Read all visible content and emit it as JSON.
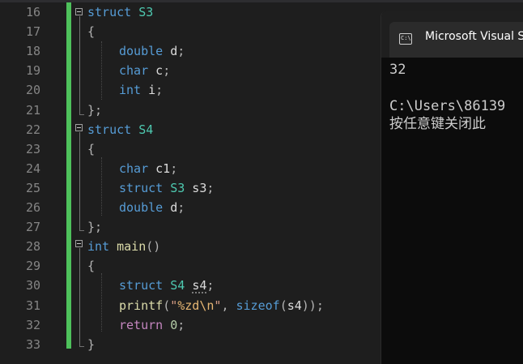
{
  "editor": {
    "lines": [
      {
        "n": "16",
        "parts": [
          [
            "kw",
            "struct"
          ],
          [
            "id",
            " "
          ],
          [
            "ty",
            "S3"
          ]
        ]
      },
      {
        "n": "17",
        "parts": [
          [
            "pu",
            "{"
          ]
        ]
      },
      {
        "n": "18",
        "parts": [
          [
            "ins",
            ""
          ],
          [
            "kw",
            "double"
          ],
          [
            "id",
            " d"
          ],
          [
            "pu",
            ";"
          ]
        ]
      },
      {
        "n": "19",
        "parts": [
          [
            "ins",
            ""
          ],
          [
            "kw",
            "char"
          ],
          [
            "id",
            " c"
          ],
          [
            "pu",
            ";"
          ]
        ]
      },
      {
        "n": "20",
        "parts": [
          [
            "ins",
            ""
          ],
          [
            "kw",
            "int"
          ],
          [
            "id",
            " i"
          ],
          [
            "pu",
            ";"
          ]
        ]
      },
      {
        "n": "21",
        "parts": [
          [
            "pu",
            "};"
          ]
        ]
      },
      {
        "n": "22",
        "parts": [
          [
            "kw",
            "struct"
          ],
          [
            "id",
            " "
          ],
          [
            "ty",
            "S4"
          ]
        ]
      },
      {
        "n": "23",
        "parts": [
          [
            "pu",
            "{"
          ]
        ]
      },
      {
        "n": "24",
        "parts": [
          [
            "ins",
            ""
          ],
          [
            "kw",
            "char"
          ],
          [
            "id",
            " c1"
          ],
          [
            "pu",
            ";"
          ]
        ]
      },
      {
        "n": "25",
        "parts": [
          [
            "ins",
            ""
          ],
          [
            "kw",
            "struct"
          ],
          [
            "id",
            " "
          ],
          [
            "ty",
            "S3"
          ],
          [
            "id",
            " s3"
          ],
          [
            "pu",
            ";"
          ]
        ]
      },
      {
        "n": "26",
        "parts": [
          [
            "ins",
            ""
          ],
          [
            "kw",
            "double"
          ],
          [
            "id",
            " d"
          ],
          [
            "pu",
            ";"
          ]
        ]
      },
      {
        "n": "27",
        "parts": [
          [
            "pu",
            "};"
          ]
        ]
      },
      {
        "n": "28",
        "parts": [
          [
            "kw",
            "int"
          ],
          [
            "id",
            " "
          ],
          [
            "fn",
            "main"
          ],
          [
            "pu",
            "()"
          ]
        ]
      },
      {
        "n": "29",
        "parts": [
          [
            "pu",
            "{"
          ]
        ]
      },
      {
        "n": "30",
        "parts": [
          [
            "ins",
            ""
          ],
          [
            "kw",
            "struct"
          ],
          [
            "id",
            " "
          ],
          [
            "ty",
            "S4"
          ],
          [
            "id",
            " "
          ],
          [
            "sq",
            "s4"
          ],
          [
            "pu",
            ";"
          ]
        ]
      },
      {
        "n": "31",
        "parts": [
          [
            "ins",
            ""
          ],
          [
            "fn",
            "printf"
          ],
          [
            "pu",
            "("
          ],
          [
            "st",
            "\""
          ],
          [
            "es",
            "%zd\\n"
          ],
          [
            "st",
            "\""
          ],
          [
            "pu",
            ", "
          ],
          [
            "kw",
            "sizeof"
          ],
          [
            "pu",
            "("
          ],
          [
            "id",
            "s4"
          ],
          [
            "pu",
            "));"
          ]
        ]
      },
      {
        "n": "32",
        "parts": [
          [
            "ins",
            ""
          ],
          [
            "pl",
            "return"
          ],
          [
            "id",
            " "
          ],
          [
            "nm",
            "0"
          ],
          [
            "pu",
            ";"
          ]
        ]
      },
      {
        "n": "33",
        "parts": [
          [
            "pu",
            "}"
          ]
        ]
      }
    ]
  },
  "console": {
    "tab_title": "Microsoft Visual S",
    "icon_text": "C:\\",
    "output_line1": "32",
    "output_line2": "",
    "output_line3": "C:\\Users\\86139",
    "output_line4": "按任意键关闭此"
  },
  "colors": {
    "editor_bg": "#1e1e1e",
    "keyword": "#569cd6",
    "type": "#4ec9b0",
    "change_bar": "#4ec15b"
  }
}
